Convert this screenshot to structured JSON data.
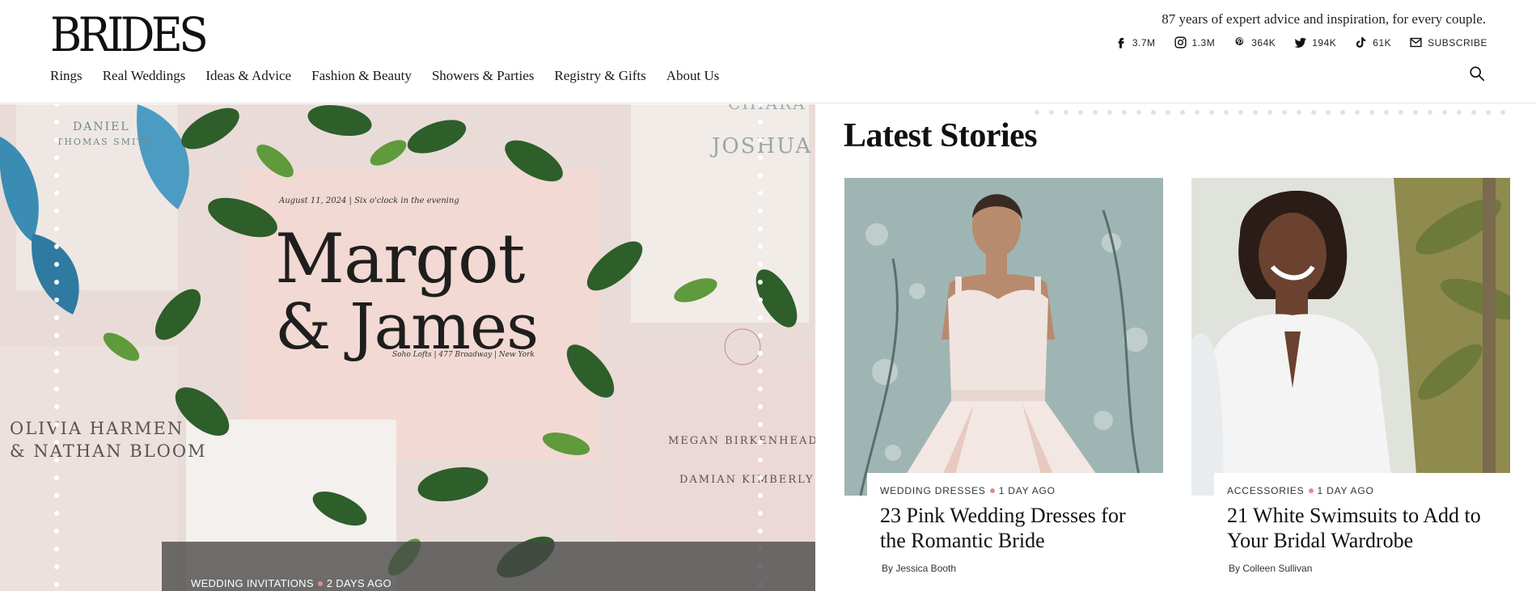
{
  "header": {
    "logo": "BRIDES",
    "tagline": "87 years of expert advice and inspiration, for every couple.",
    "social": [
      {
        "icon": "facebook-icon",
        "count": "3.7M"
      },
      {
        "icon": "instagram-icon",
        "count": "1.3M"
      },
      {
        "icon": "pinterest-icon",
        "count": "364K"
      },
      {
        "icon": "twitter-icon",
        "count": "194K"
      },
      {
        "icon": "tiktok-icon",
        "count": "61K"
      },
      {
        "icon": "mail-icon",
        "count": "SUBSCRIBE"
      }
    ],
    "nav": [
      "Rings",
      "Real Weddings",
      "Ideas & Advice",
      "Fashion & Beauty",
      "Showers & Parties",
      "Registry & Gifts",
      "About Us"
    ]
  },
  "hero": {
    "category": "WEDDING INVITATIONS",
    "age": "2 DAYS AGO",
    "art_text": {
      "big1": "Margot",
      "big2": "& James",
      "date_line": "August 11, 2024  |  Six o'clock in the evening",
      "venue_line": "Soho Lofts  |  477 Broadway  |  New York",
      "left_names1": "OLIVIA HARMEN",
      "left_names2": "& NATHAN BLOOM",
      "right_names1": "MEGAN BIRKENHEAD",
      "right_names2": "DAMIAN KIMBERLY",
      "top_right1": "CHIARA",
      "top_right2": "JOSHUA",
      "top_left1": "DANIEL",
      "top_left2": "THOMAS SMITH"
    }
  },
  "latest": {
    "heading": "Latest Stories",
    "cards": [
      {
        "category": "WEDDING DRESSES",
        "age": "1 DAY AGO",
        "title": "23 Pink Wedding Dresses for the Romantic Bride",
        "byline": "By Jessica Booth"
      },
      {
        "category": "ACCESSORIES",
        "age": "1 DAY AGO",
        "title": "21 White Swimsuits to Add to Your Bridal Wardrobe",
        "byline": "By Colleen Sullivan"
      }
    ]
  },
  "colors": {
    "accent_dot": "#e58b8b",
    "text": "#1a1a1a",
    "caption_bg": "#464646"
  }
}
